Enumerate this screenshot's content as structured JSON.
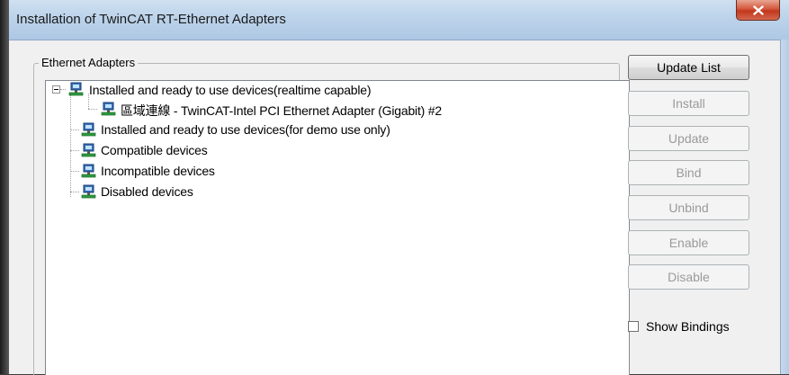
{
  "window": {
    "title": "Installation of TwinCAT RT-Ethernet Adapters"
  },
  "group": {
    "label": "Ethernet Adapters"
  },
  "tree": {
    "items": [
      {
        "label": "Installed and ready to use devices(realtime capable)",
        "expanded": true,
        "icon": "network-adapter-icon"
      },
      {
        "label": "區域連線 - TwinCAT-Intel PCI Ethernet Adapter (Gigabit) #2",
        "icon": "network-adapter-icon"
      },
      {
        "label": "Installed and ready to use devices(for demo use only)",
        "icon": "network-adapter-icon"
      },
      {
        "label": "Compatible devices",
        "icon": "network-adapter-icon"
      },
      {
        "label": "Incompatible devices",
        "icon": "network-adapter-icon"
      },
      {
        "label": "Disabled devices",
        "icon": "network-adapter-icon"
      }
    ]
  },
  "buttons": {
    "update_list": "Update List",
    "install": "Install",
    "update": "Update",
    "bind": "Bind",
    "unbind": "Unbind",
    "enable": "Enable",
    "disable": "Disable"
  },
  "options": {
    "show_bindings": "Show Bindings",
    "show_bindings_checked": false
  },
  "colors": {
    "titlebar": "#bcd3ea",
    "close": "#c2371c",
    "disabled_text": "#9a9a9a"
  }
}
